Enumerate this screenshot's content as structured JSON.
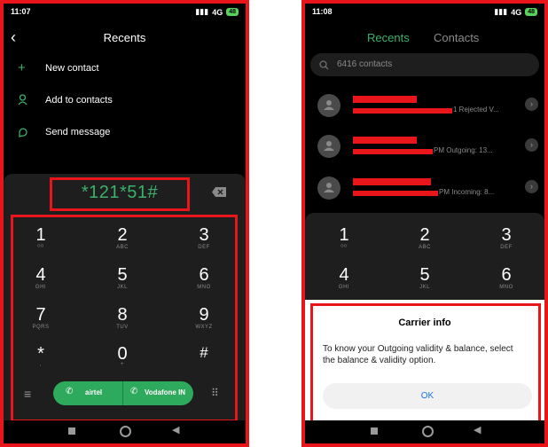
{
  "left": {
    "status": {
      "time": "11:07",
      "signal": "4G",
      "battery": "48"
    },
    "header": {
      "title": "Recents"
    },
    "menu": [
      {
        "label": "New contact",
        "icon": "plus-icon"
      },
      {
        "label": "Add to contacts",
        "icon": "person-icon"
      },
      {
        "label": "Send message",
        "icon": "chat-icon"
      }
    ],
    "dialer": {
      "input_value": "*121*51#",
      "keys": [
        {
          "num": "1",
          "sub": "ᴼᴼ"
        },
        {
          "num": "2",
          "sub": "ABC"
        },
        {
          "num": "3",
          "sub": "DEF"
        },
        {
          "num": "4",
          "sub": "GHI"
        },
        {
          "num": "5",
          "sub": "JKL"
        },
        {
          "num": "6",
          "sub": "MNO"
        },
        {
          "num": "7",
          "sub": "PQRS"
        },
        {
          "num": "8",
          "sub": "TUV"
        },
        {
          "num": "9",
          "sub": "WXYZ"
        },
        {
          "num": "*",
          "sub": ","
        },
        {
          "num": "0",
          "sub": "+"
        },
        {
          "num": "#",
          "sub": ""
        }
      ],
      "call_sim1": "airtel",
      "call_sim2": "Vodafone IN"
    }
  },
  "right": {
    "status": {
      "time": "11:08",
      "signal": "4G",
      "battery": "48"
    },
    "tabs": {
      "recents": "Recents",
      "contacts": "Contacts"
    },
    "search": {
      "placeholder": "6416 contacts"
    },
    "calls": [
      {
        "detail": "1 Rejected V..."
      },
      {
        "detail": "PM Outgoing: 13..."
      },
      {
        "detail": "PM Incoming: 8..."
      }
    ],
    "keys": [
      {
        "num": "1",
        "sub": "ᴼᴼ"
      },
      {
        "num": "2",
        "sub": "ABC"
      },
      {
        "num": "3",
        "sub": "DEF"
      },
      {
        "num": "4",
        "sub": "GHI"
      },
      {
        "num": "5",
        "sub": "JKL"
      },
      {
        "num": "6",
        "sub": "MNO"
      }
    ],
    "dialog": {
      "title": "Carrier info",
      "message": "To know your Outgoing validity & balance, select the balance & validity option.",
      "ok_label": "OK"
    }
  },
  "colors": {
    "accent_green": "#3bb26b",
    "call_green": "#2eaa5c",
    "highlight_red": "#e8151b",
    "dialog_link": "#1a73e8"
  }
}
